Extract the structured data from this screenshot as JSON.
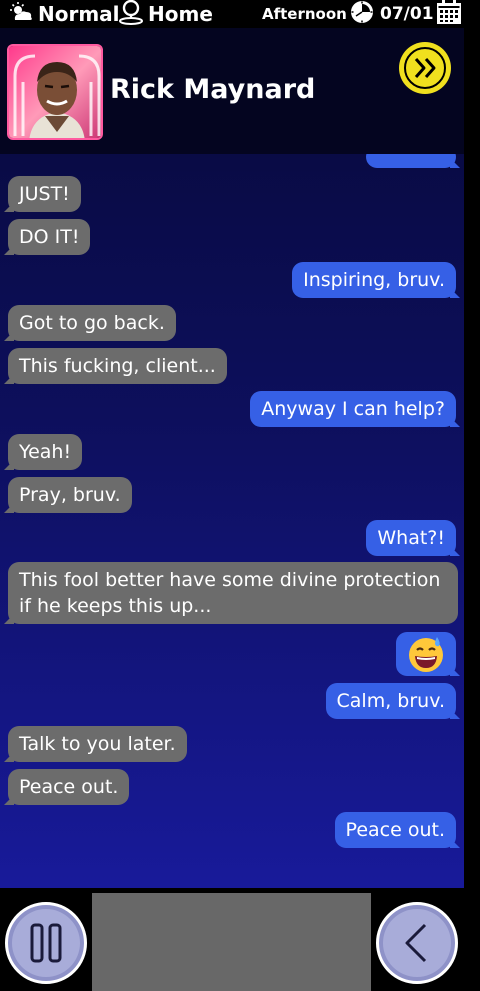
{
  "statusbar": {
    "weather": "Normal",
    "weather_icon": "weather-icon",
    "location": "Home",
    "location_icon": "location-pin-icon",
    "time_of_day": "Afternoon",
    "time_icon": "clock-icon",
    "date": "07/01",
    "date_icon": "calendar-icon"
  },
  "contact": {
    "name": "Rick Maynard"
  },
  "messages": [
    {
      "side": "received",
      "text": "JUST!"
    },
    {
      "side": "received",
      "text": "DO IT!"
    },
    {
      "side": "sent",
      "text": "Inspiring, bruv."
    },
    {
      "side": "received",
      "text": "Got to go back."
    },
    {
      "side": "received",
      "text": "This fucking, client..."
    },
    {
      "side": "sent",
      "text": "Anyway I can help?"
    },
    {
      "side": "received",
      "text": "Yeah!"
    },
    {
      "side": "received",
      "text": "Pray, bruv."
    },
    {
      "side": "sent",
      "text": "What?!"
    },
    {
      "side": "received",
      "text": "This fool better have some divine protection if he keeps this up..."
    },
    {
      "side": "sent",
      "text": "",
      "emoji": "sweat-smile-emoji-icon"
    },
    {
      "side": "sent",
      "text": "Calm, bruv."
    },
    {
      "side": "received",
      "text": "Talk to you later."
    },
    {
      "side": "received",
      "text": "Peace out."
    },
    {
      "side": "sent",
      "text": "Peace out."
    }
  ],
  "colors": {
    "received_bubble": "#6c6c6c",
    "sent_bubble": "#3660e6",
    "skip_button": "#f0e01e",
    "round_button": "#a8acd9"
  }
}
